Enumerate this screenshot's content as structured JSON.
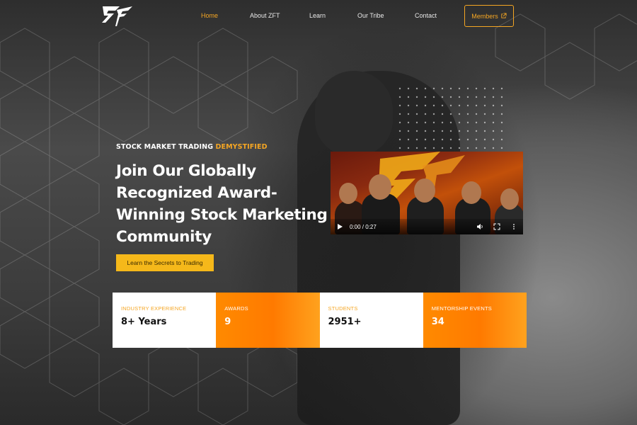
{
  "nav": {
    "items": [
      {
        "label": "Home",
        "active": true
      },
      {
        "label": "About ZFT",
        "active": false
      },
      {
        "label": "Learn",
        "active": false
      },
      {
        "label": "Our Tribe",
        "active": false
      },
      {
        "label": "Contact",
        "active": false
      }
    ],
    "members_label": "Members",
    "members_icon": "external-link-icon"
  },
  "hero": {
    "eyebrow_main": "STOCK MARKET TRADING",
    "eyebrow_highlight": "DEMYSTIFIED",
    "headline": "Join Our Globally Recognized Award-Winning Stock Marketing Community",
    "cta_label": "Learn the Secrets to Trading"
  },
  "video": {
    "time": "0:00 / 0:27"
  },
  "stats": [
    {
      "label": "INDUSTRY EXPERIENCE",
      "value": "8+ Years",
      "style": "light"
    },
    {
      "label": "AWARDS",
      "value": "9",
      "style": "orange"
    },
    {
      "label": "STUDENTS",
      "value": "2951+",
      "style": "light"
    },
    {
      "label": "MENTORSHIP EVENTS",
      "value": "34",
      "style": "orange"
    }
  ],
  "colors": {
    "accent": "#f5a623",
    "cta": "#f5b81a",
    "orange": "#ff7a00"
  }
}
